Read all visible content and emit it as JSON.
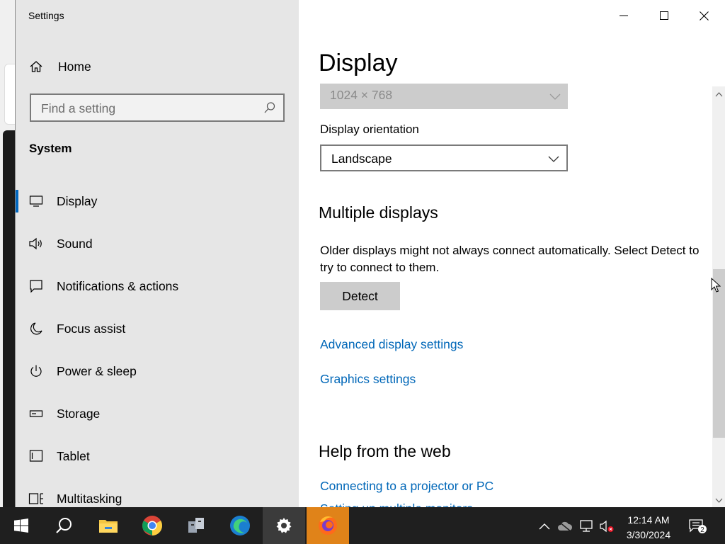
{
  "window": {
    "app_title": "Settings",
    "minimize_label": "Minimize",
    "maximize_label": "Maximize",
    "close_label": "Close"
  },
  "sidebar": {
    "home": "Home",
    "search_placeholder": "Find a setting",
    "section": "System",
    "items": [
      {
        "label": "Display",
        "icon": "monitor-icon",
        "active": true
      },
      {
        "label": "Sound",
        "icon": "speaker-icon"
      },
      {
        "label": "Notifications & actions",
        "icon": "notification-icon"
      },
      {
        "label": "Focus assist",
        "icon": "moon-icon"
      },
      {
        "label": "Power & sleep",
        "icon": "power-icon"
      },
      {
        "label": "Storage",
        "icon": "storage-icon"
      },
      {
        "label": "Tablet",
        "icon": "tablet-icon"
      },
      {
        "label": "Multitasking",
        "icon": "multitasking-icon"
      }
    ]
  },
  "main": {
    "title": "Display",
    "resolution_value": "1024 × 768",
    "orientation_label": "Display orientation",
    "orientation_value": "Landscape",
    "multiple_displays_heading": "Multiple displays",
    "multiple_displays_text": "Older displays might not always connect automatically. Select Detect to try to connect to them.",
    "detect_button": "Detect",
    "advanced_link": "Advanced display settings",
    "graphics_link": "Graphics settings",
    "help_heading": "Help from the web",
    "help_link_1": "Connecting to a projector or PC",
    "help_link_2": "Setting up multiple monitors"
  },
  "taskbar": {
    "apps": [
      "start-icon",
      "search-icon",
      "file-explorer-icon",
      "chrome-icon",
      "network-app-icon",
      "edge-icon",
      "settings-icon",
      "firefox-icon"
    ],
    "clock_time": "12:14 AM",
    "clock_date": "3/30/2024",
    "notification_count": "2"
  },
  "colors": {
    "accent": "#0067c0",
    "link": "#0067b8",
    "sidebar_bg": "#e6e6e6",
    "taskbar_bg": "#1f1f1f"
  }
}
